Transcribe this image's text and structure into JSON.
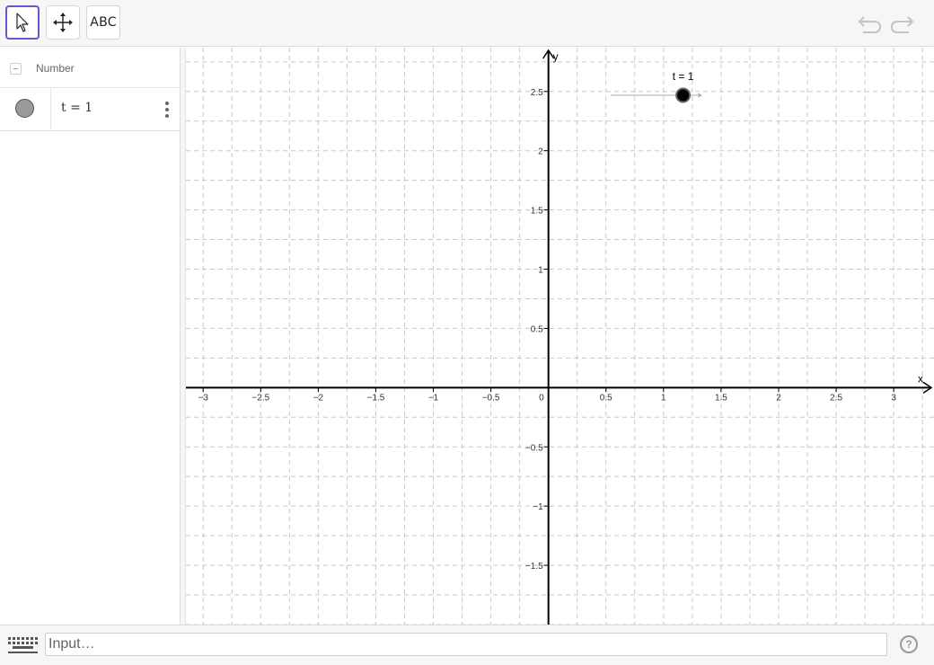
{
  "toolbar": {
    "tools": [
      {
        "name": "move-tool",
        "icon": "cursor-arrow-icon"
      },
      {
        "name": "move-graphics-view-tool",
        "icon": "four-way-arrow-icon"
      },
      {
        "name": "text-tool",
        "icon": "text-icon",
        "label": "ABC"
      }
    ],
    "active_tool": "move-tool",
    "accent": "#6557d2",
    "undo_icon": "undo-icon",
    "redo_icon": "redo-icon"
  },
  "algebra": {
    "group_label": "Number",
    "items": [
      {
        "text": "t = 1",
        "visible": true
      }
    ]
  },
  "graphics": {
    "x_axis_label": "x",
    "y_axis_label": "y",
    "x_ticks": [
      "−3",
      "−2.5",
      "−2",
      "−1.5",
      "−1",
      "−0.5",
      "0",
      "0.5",
      "1",
      "1.5",
      "2",
      "2.5",
      "3"
    ],
    "y_ticks": [
      "2.5",
      "2",
      "1.5",
      "1",
      "0.5",
      "−0.5",
      "−1",
      "−1.5"
    ],
    "x_range": [
      -3.15,
      3.35
    ],
    "y_range": [
      -2.0,
      2.87
    ],
    "grid": true,
    "slider": {
      "name": "t",
      "label": "t = 1",
      "value": 1,
      "min": -5,
      "max": 5
    }
  },
  "inputbar": {
    "placeholder": "Input…",
    "keyboard_icon": "keyboard-icon",
    "help_label": "?"
  }
}
